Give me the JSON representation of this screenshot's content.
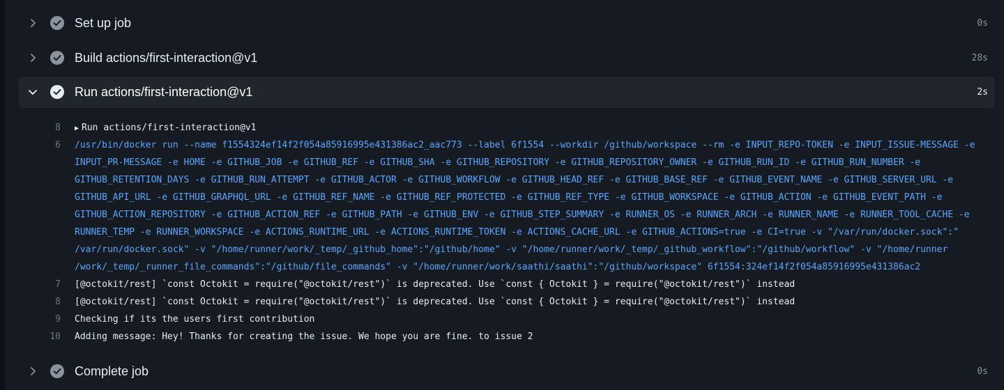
{
  "steps": [
    {
      "title": "Set up job",
      "duration": "0s",
      "expanded": false
    },
    {
      "title": "Build actions/first-interaction@v1",
      "duration": "28s",
      "expanded": false
    },
    {
      "title": "Run actions/first-interaction@v1",
      "duration": "2s",
      "expanded": true
    },
    {
      "title": "Complete job",
      "duration": "0s",
      "expanded": false
    }
  ],
  "log": {
    "group": {
      "number": "8",
      "label": "Run actions/first-interaction@v1"
    },
    "lines": [
      {
        "number": "6",
        "text": "/usr/bin/docker run --name f1554324ef14f2f054a85916995e431386ac2_aac773 --label 6f1554 --workdir /github/workspace --rm -e INPUT_REPO-TOKEN -e INPUT_ISSUE-MESSAGE -e"
      },
      {
        "number": "",
        "text": "INPUT_PR-MESSAGE -e HOME -e GITHUB_JOB -e GITHUB_REF -e GITHUB_SHA -e GITHUB_REPOSITORY -e GITHUB_REPOSITORY_OWNER -e GITHUB_RUN_ID -e GITHUB_RUN_NUMBER -e"
      },
      {
        "number": "",
        "text": "GITHUB_RETENTION_DAYS -e GITHUB_RUN_ATTEMPT -e GITHUB_ACTOR -e GITHUB_WORKFLOW -e GITHUB_HEAD_REF -e GITHUB_BASE_REF -e GITHUB_EVENT_NAME -e GITHUB_SERVER_URL -e"
      },
      {
        "number": "",
        "text": "GITHUB_API_URL -e GITHUB_GRAPHQL_URL -e GITHUB_REF_NAME -e GITHUB_REF_PROTECTED -e GITHUB_REF_TYPE -e GITHUB_WORKSPACE -e GITHUB_ACTION -e GITHUB_EVENT_PATH -e"
      },
      {
        "number": "",
        "text": "GITHUB_ACTION_REPOSITORY -e GITHUB_ACTION_REF -e GITHUB_PATH -e GITHUB_ENV -e GITHUB_STEP_SUMMARY -e RUNNER_OS -e RUNNER_ARCH -e RUNNER_NAME -e RUNNER_TOOL_CACHE -e"
      },
      {
        "number": "",
        "text": "RUNNER_TEMP -e RUNNER_WORKSPACE -e ACTIONS_RUNTIME_URL -e ACTIONS_RUNTIME_TOKEN -e ACTIONS_CACHE_URL -e GITHUB_ACTIONS=true -e CI=true -v \"/var/run/docker.sock\":\""
      },
      {
        "number": "",
        "text": "/var/run/docker.sock\" -v \"/home/runner/work/_temp/_github_home\":\"/github/home\" -v \"/home/runner/work/_temp/_github_workflow\":\"/github/workflow\" -v \"/home/runner"
      },
      {
        "number": "",
        "text": "/work/_temp/_runner_file_commands\":\"/github/file_commands\" -v \"/home/runner/work/saathi/saathi\":\"/github/workspace\" 6f1554:324ef14f2f054a85916995e431386ac2"
      },
      {
        "number": "7",
        "text": "[@octokit/rest] `const Octokit = require(\"@octokit/rest\")` is deprecated. Use `const { Octokit } = require(\"@octokit/rest\")` instead"
      },
      {
        "number": "8",
        "text": "[@octokit/rest] `const Octokit = require(\"@octokit/rest\")` is deprecated. Use `const { Octokit } = require(\"@octokit/rest\")` instead"
      },
      {
        "number": "9",
        "text": "Checking if its the users first contribution"
      },
      {
        "number": "10",
        "text": "Adding message: Hey! Thanks for creating the issue. We hope you are fine. to issue 2"
      }
    ]
  },
  "colors": {
    "background": "#161b22",
    "active_step": "#21262d",
    "command_text": "#58a6ff",
    "check_icon": "#8b949e"
  }
}
